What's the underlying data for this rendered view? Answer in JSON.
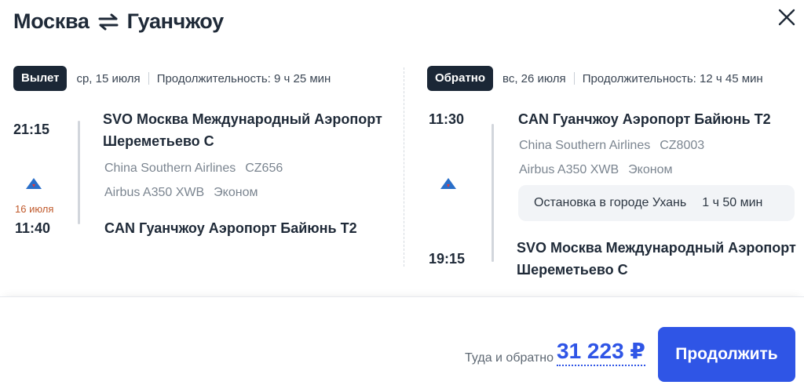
{
  "header": {
    "origin": "Москва",
    "destination": "Гуанчжоу",
    "swap_icon": "swap-arrows-icon",
    "close_icon": "close-icon"
  },
  "outbound": {
    "badge": "Вылет",
    "date": "ср, 15 июля",
    "duration": "Продолжительность: 9 ч 25 мин",
    "depart_time": "21:15",
    "depart_airport": "SVO Москва Международный Аэропорт Шереметьево C",
    "airline": "China Southern Airlines",
    "flight": "CZ656",
    "aircraft": "Airbus A350 XWB",
    "cabin": "Эконом",
    "arrival_day_note": "16 июля",
    "arrive_time": "11:40",
    "arrive_airport": "CAN Гуанчжоу Аэропорт Байюнь T2",
    "airline_icon": "china-southern-logo-icon"
  },
  "return": {
    "badge": "Обратно",
    "date": "вс, 26 июля",
    "duration": "Продолжительность: 12 ч 45 мин",
    "depart_time": "11:30",
    "depart_airport": "CAN Гуанчжоу Аэропорт Байюнь T2",
    "airline": "China Southern Airlines",
    "flight": "CZ8003",
    "aircraft": "Airbus A350 XWB",
    "cabin": "Эконом",
    "stop_text": "Остановка в городе Ухань",
    "stop_duration": "1 ч 50 мин",
    "arrive_time": "19:15",
    "arrive_airport": "SVO Москва Международный Аэропорт Шереметьево C",
    "airline_icon": "china-southern-logo-icon"
  },
  "footer": {
    "total_label": "Туда и обратно",
    "price": "31 223 ₽",
    "continue_label": "Продолжить"
  },
  "colors": {
    "accent": "#2f55e6",
    "badge_bg": "#1b2736",
    "next_day": "#c05a2c"
  }
}
